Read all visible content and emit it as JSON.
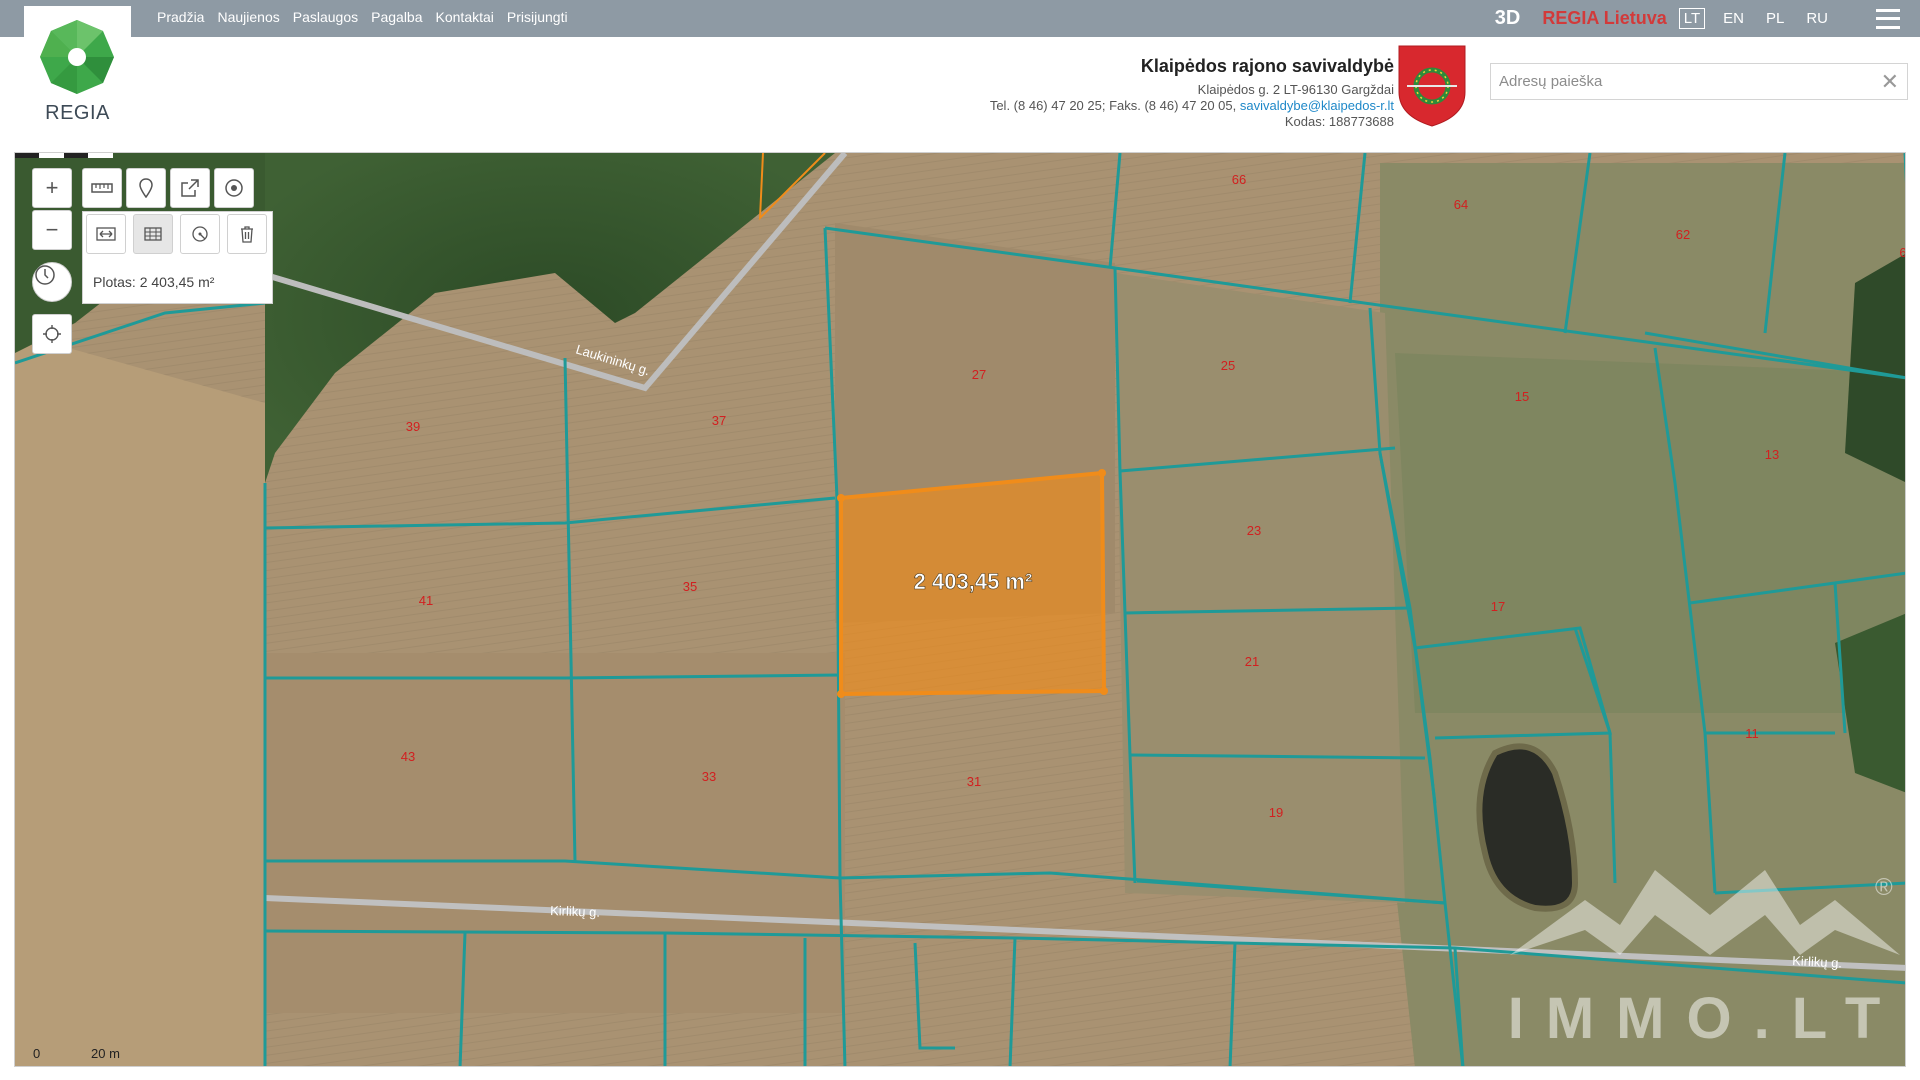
{
  "header": {
    "logo_text": "REGIA",
    "nav": [
      "Pradžia",
      "Naujienos",
      "Paslaugos",
      "Pagalba",
      "Kontaktai",
      "Prisijungti"
    ],
    "btn_3d": "3D",
    "regia_lietuva": "REGIA Lietuva",
    "languages": [
      "LT",
      "EN",
      "PL",
      "RU"
    ],
    "active_language": "LT"
  },
  "municipality": {
    "title": "Klaipėdos rajono savivaldybė",
    "address": "Klaipėdos g. 2 LT-96130 Gargždai",
    "contact": "Tel. (8 46) 47 20 25; Faks. (8 46) 47 20 05,",
    "email": "savivaldybe@klaipedos-r.lt",
    "code": "Kodas: 188773688"
  },
  "search": {
    "placeholder": "Adresų paieška",
    "value": ""
  },
  "measure": {
    "plotas": "Plotas: 2 403,45 m²",
    "area_label": "2 403,45 m²"
  },
  "map": {
    "streets": [
      "Laukininkų g.",
      "Kirlikų g.",
      "Kirlikų g."
    ],
    "parcel_numbers": [
      "66",
      "64",
      "62",
      "6",
      "27",
      "25",
      "15",
      "39",
      "37",
      "13",
      "23",
      "41",
      "35",
      "17",
      "21",
      "43",
      "33",
      "31",
      "19",
      "11"
    ],
    "scale": {
      "zero": "0",
      "distance": "20 m"
    }
  },
  "watermark": {
    "text": "IMMO.LT",
    "registered": "®"
  },
  "colors": {
    "topbar": "#8e9aa4",
    "parcel_line": "#1f9a98",
    "selection": "#f08c1a",
    "parcel_label": "#d22020"
  }
}
